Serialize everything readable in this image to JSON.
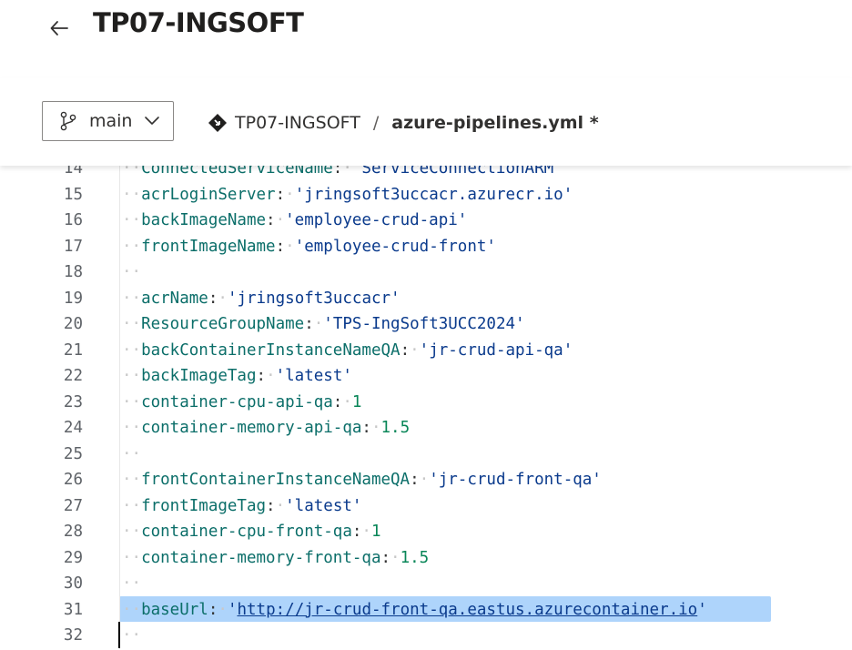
{
  "header": {
    "title": "TP07-INGSOFT",
    "back_icon": "arrow-left-icon"
  },
  "toolbar": {
    "branch": "main",
    "repo": "TP07-INGSOFT",
    "separator": "/",
    "file": "azure-pipelines.yml *"
  },
  "editor": {
    "lines": [
      {
        "num": "14",
        "key": "ConnectedServiceName",
        "value": "'ServiceConnectionARM'"
      },
      {
        "num": "15",
        "key": "acrLoginServer",
        "value": "'jringsoft3uccacr.azurecr.io'"
      },
      {
        "num": "16",
        "key": "backImageName",
        "value": "'employee-crud-api'"
      },
      {
        "num": "17",
        "key": "frontImageName",
        "value": "'employee-crud-front'"
      },
      {
        "num": "18",
        "key": "",
        "value": ""
      },
      {
        "num": "19",
        "key": "acrName",
        "value": "'jringsoft3uccacr'"
      },
      {
        "num": "20",
        "key": "ResourceGroupName",
        "value": "'TPS-IngSoft3UCC2024'"
      },
      {
        "num": "21",
        "key": "backContainerInstanceNameQA",
        "value": "'jr-crud-api-qa'"
      },
      {
        "num": "22",
        "key": "backImageTag",
        "value": "'latest'"
      },
      {
        "num": "23",
        "key": "container-cpu-api-qa",
        "value": "1"
      },
      {
        "num": "24",
        "key": "container-memory-api-qa",
        "value": "1.5"
      },
      {
        "num": "25",
        "key": "",
        "value": ""
      },
      {
        "num": "26",
        "key": "frontContainerInstanceNameQA",
        "value": "'jr-crud-front-qa'"
      },
      {
        "num": "27",
        "key": "frontImageTag",
        "value": "'latest'"
      },
      {
        "num": "28",
        "key": "container-cpu-front-qa",
        "value": "1"
      },
      {
        "num": "29",
        "key": "container-memory-front-qa",
        "value": "1.5"
      },
      {
        "num": "30",
        "key": "",
        "value": ""
      },
      {
        "num": "31",
        "key": "baseUrl",
        "value": "'http://jr-crud-front-qa.eastus.azurecontainer.io'"
      },
      {
        "num": "32",
        "key": "",
        "value": ""
      }
    ]
  }
}
